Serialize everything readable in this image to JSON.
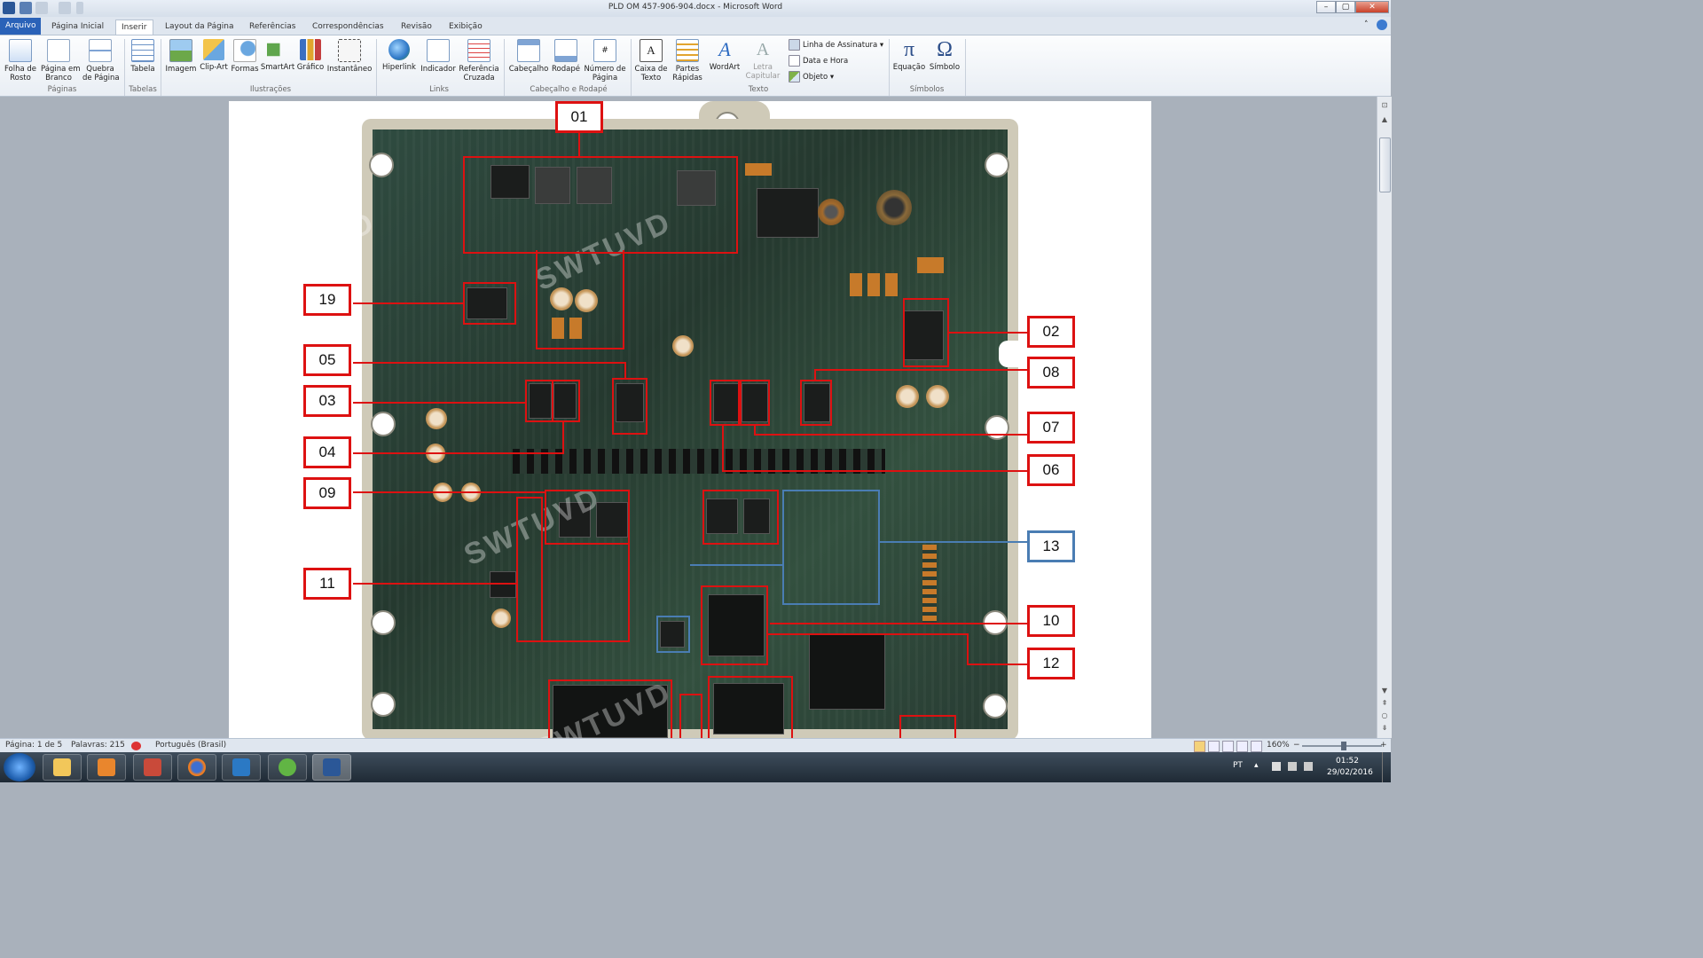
{
  "window": {
    "title": "PLD OM 457-906-904.docx  -  Microsoft Word",
    "controls": {
      "minimize": "–",
      "maximize": "▢",
      "close": "✕"
    }
  },
  "tabs": [
    {
      "label": "Arquivo"
    },
    {
      "label": "Página Inicial"
    },
    {
      "label": "Inserir"
    },
    {
      "label": "Layout da Página"
    },
    {
      "label": "Referências"
    },
    {
      "label": "Correspondências"
    },
    {
      "label": "Revisão"
    },
    {
      "label": "Exibição"
    }
  ],
  "ribbon": {
    "paginas": {
      "group": "Páginas",
      "folha": "Folha de\nRosto",
      "branco": "Página em\nBranco",
      "quebra": "Quebra\nde Página"
    },
    "tabelas": {
      "group": "Tabelas",
      "tabela": "Tabela"
    },
    "ilustracoes": {
      "group": "Ilustrações",
      "imagem": "Imagem",
      "clipart": "Clip-Art",
      "formas": "Formas",
      "smartart": "SmartArt",
      "grafico": "Gráfico",
      "instantaneo": "Instantâneo"
    },
    "links": {
      "group": "Links",
      "hiperlink": "Hiperlink",
      "indicador": "Indicador",
      "referencia": "Referência\nCruzada"
    },
    "cabecalho": {
      "group": "Cabeçalho e Rodapé",
      "cabecalho": "Cabeçalho",
      "rodape": "Rodapé",
      "numero": "Número de\nPágina"
    },
    "texto": {
      "group": "Texto",
      "caixa": "Caixa de\nTexto",
      "partes": "Partes\nRápidas",
      "wordart": "WordArt",
      "letra": "Letra\nCapitular",
      "assinatura": "Linha de Assinatura",
      "data": "Data e Hora",
      "objeto": "Objeto"
    },
    "simbolos": {
      "group": "Símbolos",
      "equacao": "Equação",
      "simbolo": "Símbolo"
    }
  },
  "document": {
    "watermark": "SWTUVD",
    "labels": [
      "01",
      "02",
      "03",
      "04",
      "05",
      "06",
      "07",
      "08",
      "09",
      "10",
      "11",
      "12",
      "13",
      "19"
    ]
  },
  "status": {
    "page": "Página: 1 de 5",
    "words": "Palavras: 215",
    "language": "Português (Brasil)",
    "zoom": "160%",
    "zoom_minus": "−",
    "zoom_plus": "+"
  },
  "taskbar": {
    "lang": "PT",
    "time": "01:52",
    "date": "29/02/2016"
  }
}
